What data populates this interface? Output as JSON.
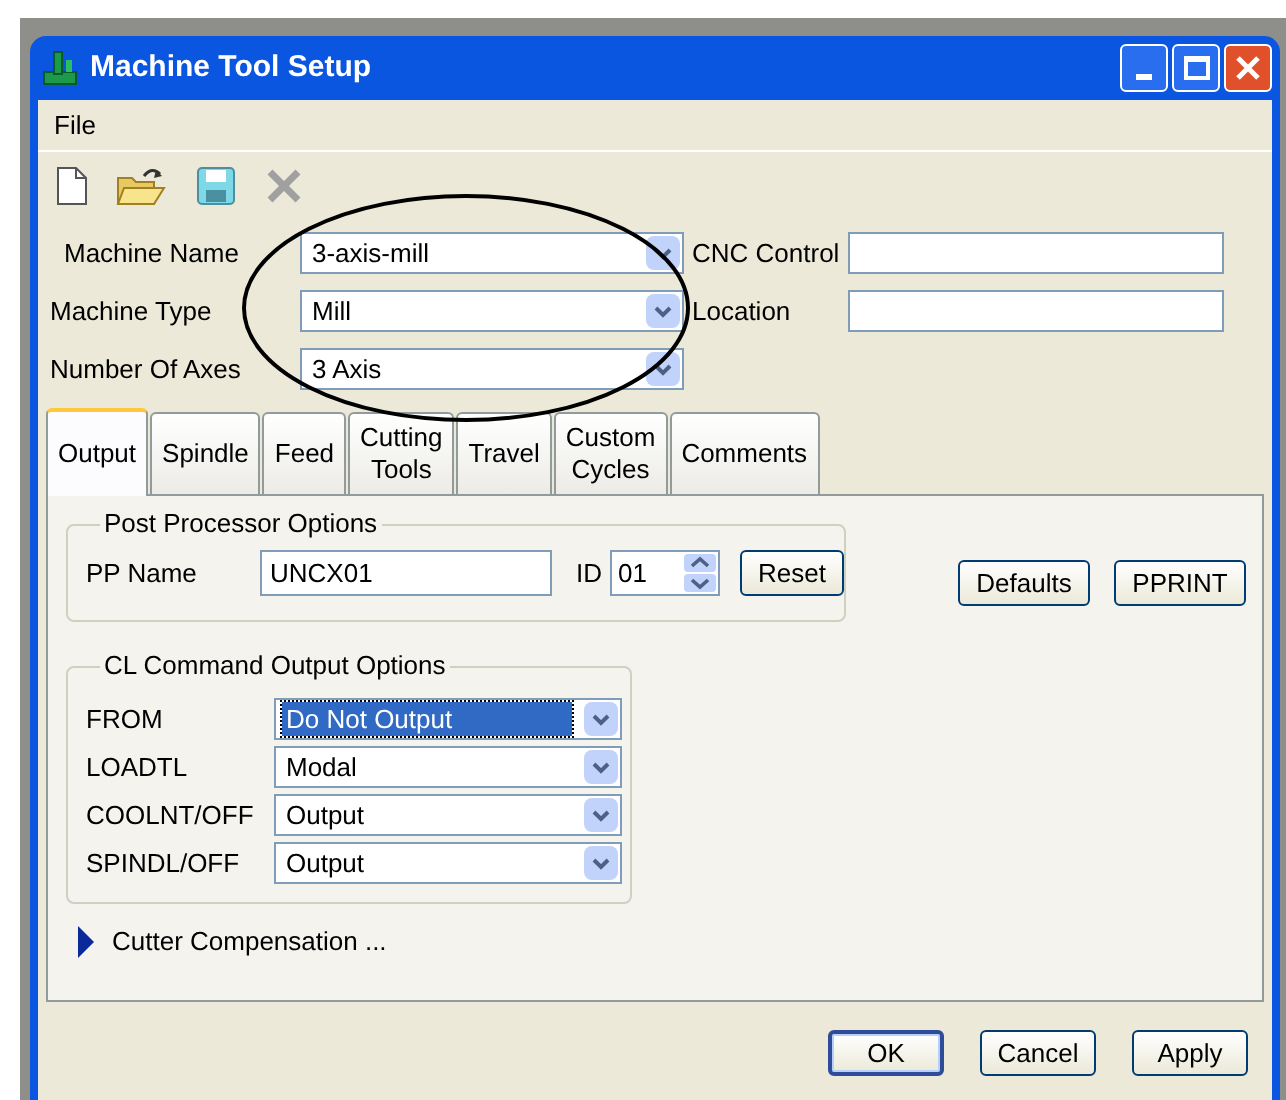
{
  "window": {
    "title": "Machine Tool Setup"
  },
  "menu": [
    "File"
  ],
  "toolbar": [
    {
      "kind": "new",
      "disabled": false
    },
    {
      "kind": "open",
      "disabled": false
    },
    {
      "kind": "save",
      "disabled": false
    },
    {
      "kind": "delete",
      "disabled": true
    }
  ],
  "machine_fields": [
    {
      "label": "Machine Name",
      "value": "3-axis-mill"
    },
    {
      "label": "Machine Type",
      "value": "Mill"
    },
    {
      "label": "Number Of Axes",
      "value": "3 Axis"
    }
  ],
  "info_fields": [
    {
      "label": "CNC Control"
    },
    {
      "label": "Location"
    }
  ],
  "tabs": [
    {
      "label": "Output",
      "selected": true
    },
    {
      "label": "Spindle",
      "selected": false
    },
    {
      "label": "Feed",
      "selected": false
    },
    {
      "label": "Cutting\nTools",
      "selected": false
    },
    {
      "label": "Travel",
      "selected": false
    },
    {
      "label": "Custom\nCycles",
      "selected": false
    },
    {
      "label": "Comments",
      "selected": false
    }
  ],
  "post_processor": {
    "title": "Post Processor Options",
    "pp_name_label": "PP Name",
    "pp_name": "UNCX01",
    "id_label": "ID",
    "id": "01",
    "reset_button": "Reset"
  },
  "side_buttons": [
    "Defaults",
    "PPRINT"
  ],
  "cl_options": {
    "title": "CL Command Output Options",
    "rows": [
      {
        "label": "FROM",
        "value": "Do Not Output",
        "selected": true
      },
      {
        "label": "LOADTL",
        "value": "Modal",
        "selected": false
      },
      {
        "label": "COOLNT/OFF",
        "value": "Output",
        "selected": false
      },
      {
        "label": "SPINDL/OFF",
        "value": "Output",
        "selected": false
      }
    ]
  },
  "cutter_compensation": {
    "label": "Cutter Compensation ...",
    "expanded": false
  },
  "footer_buttons": [
    {
      "label": "OK",
      "default": true
    },
    {
      "label": "Cancel",
      "default": false
    },
    {
      "label": "Apply",
      "default": false
    }
  ]
}
